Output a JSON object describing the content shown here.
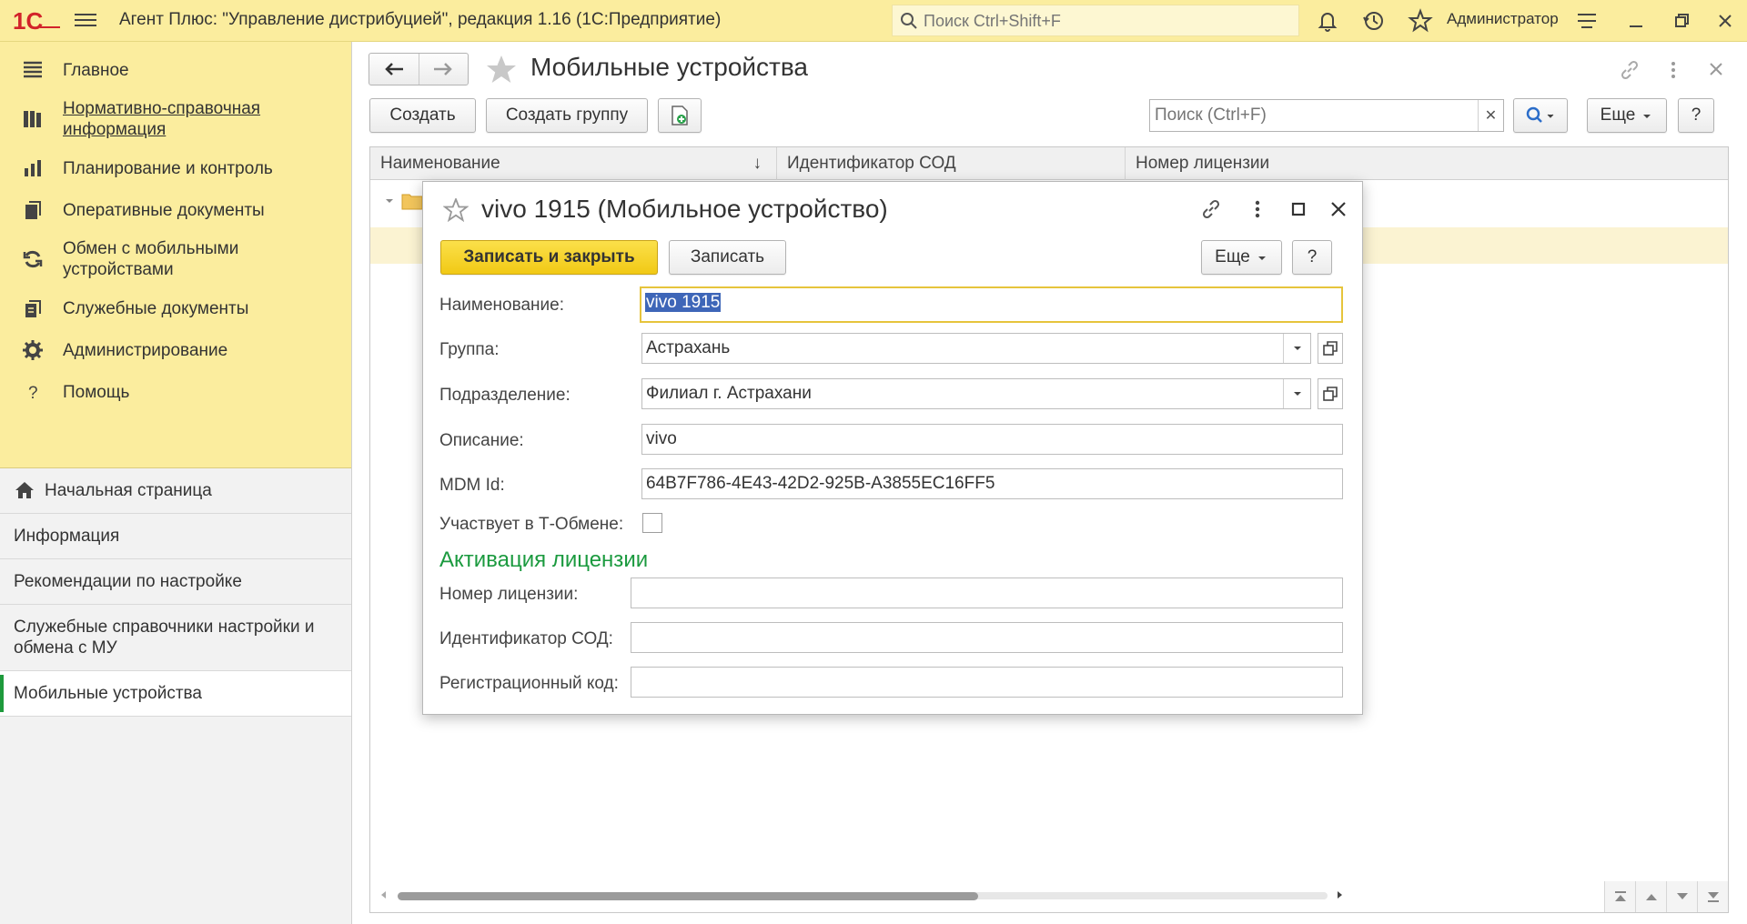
{
  "app": {
    "title": "Агент Плюс: \"Управление дистрибуцией\", редакция 1.16  (1С:Предприятие)",
    "search_placeholder": "Поиск Ctrl+Shift+F",
    "user": "Администратор",
    "logo_text": "1С"
  },
  "sections": [
    {
      "label": "Главное",
      "icon": "list-icon"
    },
    {
      "label": "Нормативно-справочная информация",
      "icon": "books-icon",
      "underline": true
    },
    {
      "label": "Планирование и контроль",
      "icon": "bar-chart-icon"
    },
    {
      "label": "Оперативные документы",
      "icon": "documents-icon"
    },
    {
      "label": "Обмен с мобильными устройствами",
      "icon": "sync-icon"
    },
    {
      "label": "Служебные документы",
      "icon": "service-docs-icon"
    },
    {
      "label": "Администрирование",
      "icon": "gear-icon"
    },
    {
      "label": "Помощь",
      "icon": "help-icon"
    }
  ],
  "nav": {
    "home": "Начальная страница",
    "items": [
      "Информация",
      "Рекомендации по настройке",
      "Служебные справочники настройки и обмена с МУ",
      "Мобильные устройства"
    ]
  },
  "list_form": {
    "title": "Мобильные устройства",
    "create": "Создать",
    "create_group": "Создать группу",
    "search_placeholder": "Поиск (Ctrl+F)",
    "more": "Еще",
    "help": "?",
    "columns": [
      "Наименование",
      "Идентификатор СОД",
      "Номер лицензии"
    ],
    "sort_indicator": "↓"
  },
  "dialog": {
    "title": "vivo 1915 (Мобильное устройство)",
    "save_close": "Записать и закрыть",
    "save": "Записать",
    "more": "Еще",
    "help": "?",
    "labels": {
      "name": "Наименование:",
      "group": "Группа:",
      "division": "Подразделение:",
      "description": "Описание:",
      "mdm": "MDM Id:",
      "t_exchange": "Участвует в Т-Обмене:",
      "license_number": "Номер лицензии:",
      "sod_id": "Идентификатор СОД:",
      "reg_code": "Регистрационный код:"
    },
    "values": {
      "name": "vivo 1915",
      "group": "Астрахань",
      "division": "Филиал г. Астрахани",
      "description": "vivo",
      "mdm": "64B7F786-4E43-42D2-925B-A3855EC16FF5",
      "license_number": "",
      "sod_id": "    -    -    -    -",
      "reg_code": ""
    },
    "t_exchange_checked": false,
    "license_group_title": "Активация лицензии"
  },
  "colors": {
    "topbar": "#fbed9e",
    "accent_button": "#f6d52a",
    "group_title": "#1b9a3f",
    "selection": "#3e66b8"
  }
}
